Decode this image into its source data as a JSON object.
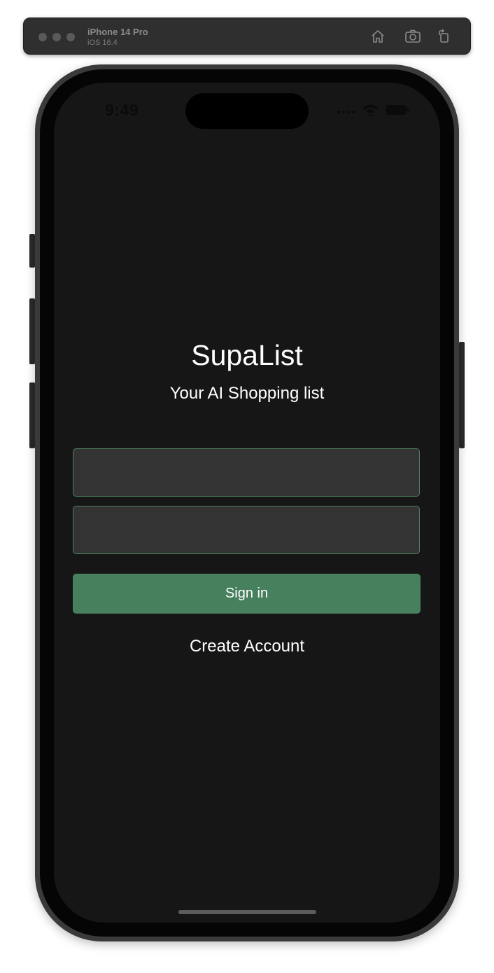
{
  "simulator": {
    "device_name": "iPhone 14 Pro",
    "os_version": "iOS 16.4",
    "toolbar_icons": [
      "home-icon",
      "screenshot-icon",
      "rotate-icon"
    ]
  },
  "status_bar": {
    "time": "9:49",
    "icons": [
      "cellular-dots-icon",
      "wifi-icon",
      "battery-icon"
    ]
  },
  "app": {
    "title": "SupaList",
    "subtitle": "Your AI Shopping list"
  },
  "form": {
    "email_value": "",
    "password_value": "",
    "sign_in_label": "Sign in",
    "create_account_label": "Create Account"
  },
  "colors": {
    "screen_background": "#161616",
    "field_background": "#333333",
    "field_border": "#4d7f5d",
    "primary_button": "#47805c",
    "text": "#ffffff"
  }
}
